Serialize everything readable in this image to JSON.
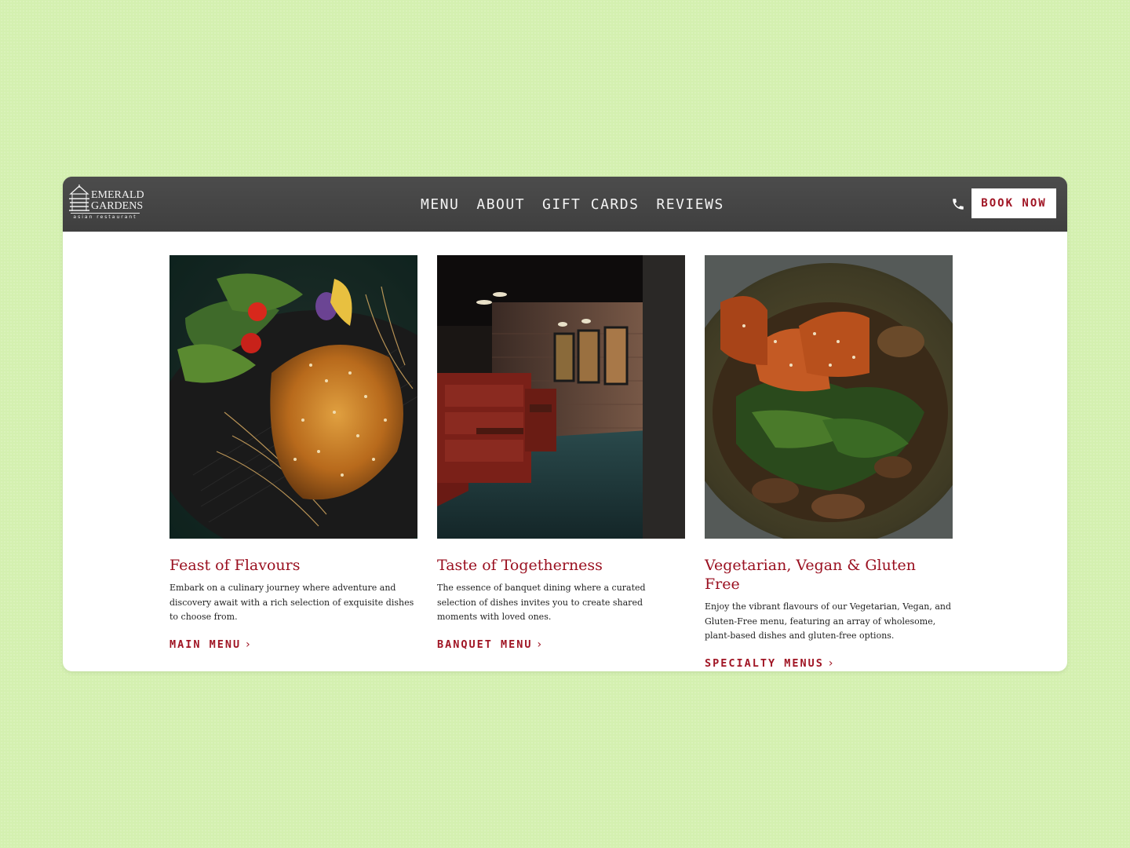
{
  "brand": {
    "name_line1": "EMERALD",
    "name_line2": "GARDENS",
    "tagline": "asian restaurant"
  },
  "nav": {
    "items": [
      {
        "label": "MENU"
      },
      {
        "label": "ABOUT"
      },
      {
        "label": "GIFT CARDS"
      },
      {
        "label": "REVIEWS"
      }
    ],
    "phone_icon": "phone-icon",
    "book_label": "BOOK NOW"
  },
  "cards": [
    {
      "title": "Feast of Flavours",
      "description": "Embark on a culinary journey where adventure and discovery await with a rich selection of exquisite dishes to choose from.",
      "link": "MAIN MENU",
      "image": "sesame chicken dish with salad"
    },
    {
      "title": "Taste of Togetherness",
      "description": "The essence of banquet dining where a curated selection of dishes invites you to create shared moments with loved ones.",
      "link": "BANQUET MENU",
      "image": "restaurant dining room with red booths"
    },
    {
      "title": "Vegetarian, Vegan & Gluten Free",
      "description": "Enjoy the vibrant flavours of our Vegetarian, Vegan, and Gluten-Free menu, featuring an array of wholesome, plant-based dishes and gluten-free options.",
      "link": "SPECIALTY MENUS",
      "image": "tofu and greens in a bowl"
    }
  ],
  "colors": {
    "background": "#d4f0b0",
    "navbar": "#474747",
    "accent": "#a01524"
  }
}
